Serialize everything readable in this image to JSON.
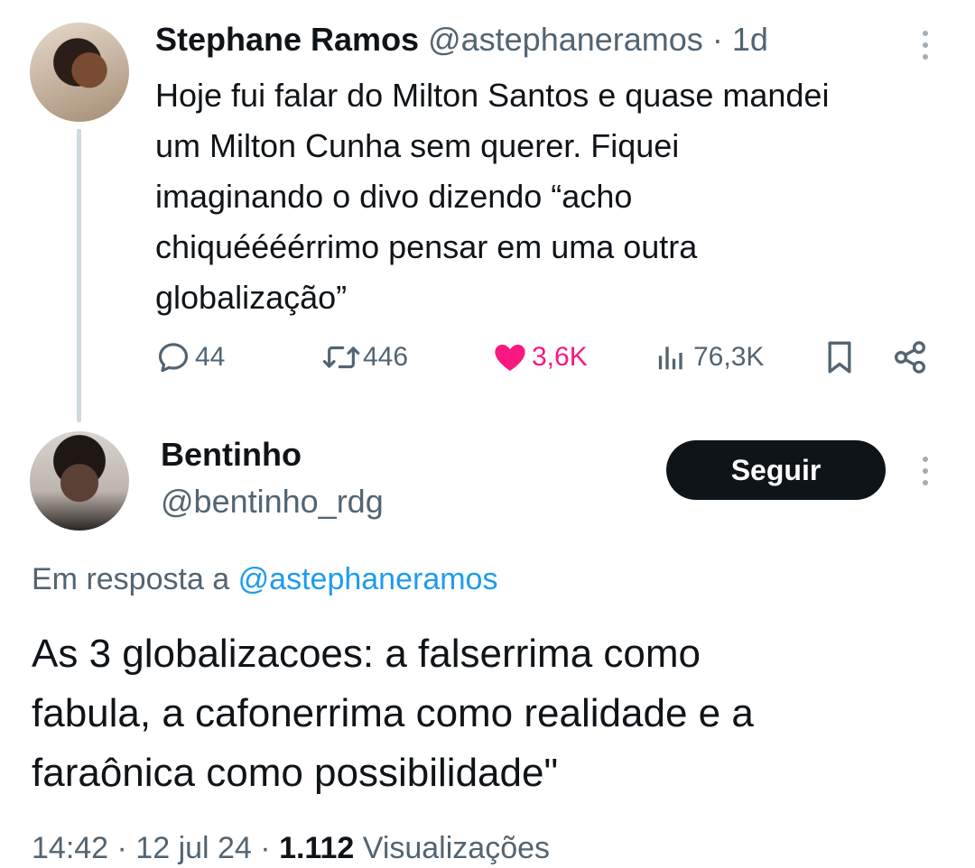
{
  "tweet1": {
    "author_name": "Stephane Ramos",
    "handle": "@astephaneramos",
    "separator": "·",
    "time": "1d",
    "text_lines": [
      "Hoje fui falar do Milton Santos e quase mandei",
      "um Milton Cunha sem querer. Fiquei",
      "imaginando o divo dizendo “acho",
      "chiquéééérrimo pensar em uma outra",
      "globalização”"
    ],
    "replies": "44",
    "retweets": "446",
    "likes": "3,6K",
    "views": "76,3K",
    "icons": {
      "reply": "reply-icon",
      "retweet": "retweet-icon",
      "like": "heart-icon",
      "views": "views-icon",
      "bookmark": "bookmark-icon",
      "share": "share-icon",
      "more": "more-icon"
    },
    "colors": {
      "like_active": "#f91880",
      "muted": "#536471"
    }
  },
  "tweet2": {
    "author_name": "Bentinho",
    "handle": "@bentinho_rdg",
    "follow_label": "Seguir",
    "reply_prefix": "Em resposta a",
    "reply_mention": "@astephaneramos",
    "text_lines": [
      "As 3 globalizacoes: a falserrima como",
      "fabula, a cafonerrima como realidade e a",
      "faraônica como possibilidade\""
    ],
    "colors": {
      "mention": "#1d9bf0",
      "follow_bg": "#0f1419"
    }
  },
  "footer_partial": {
    "time_date": "14:42 · 12 jul 24 ·",
    "views_count": "1.112",
    "views_label": "Visualizações"
  }
}
